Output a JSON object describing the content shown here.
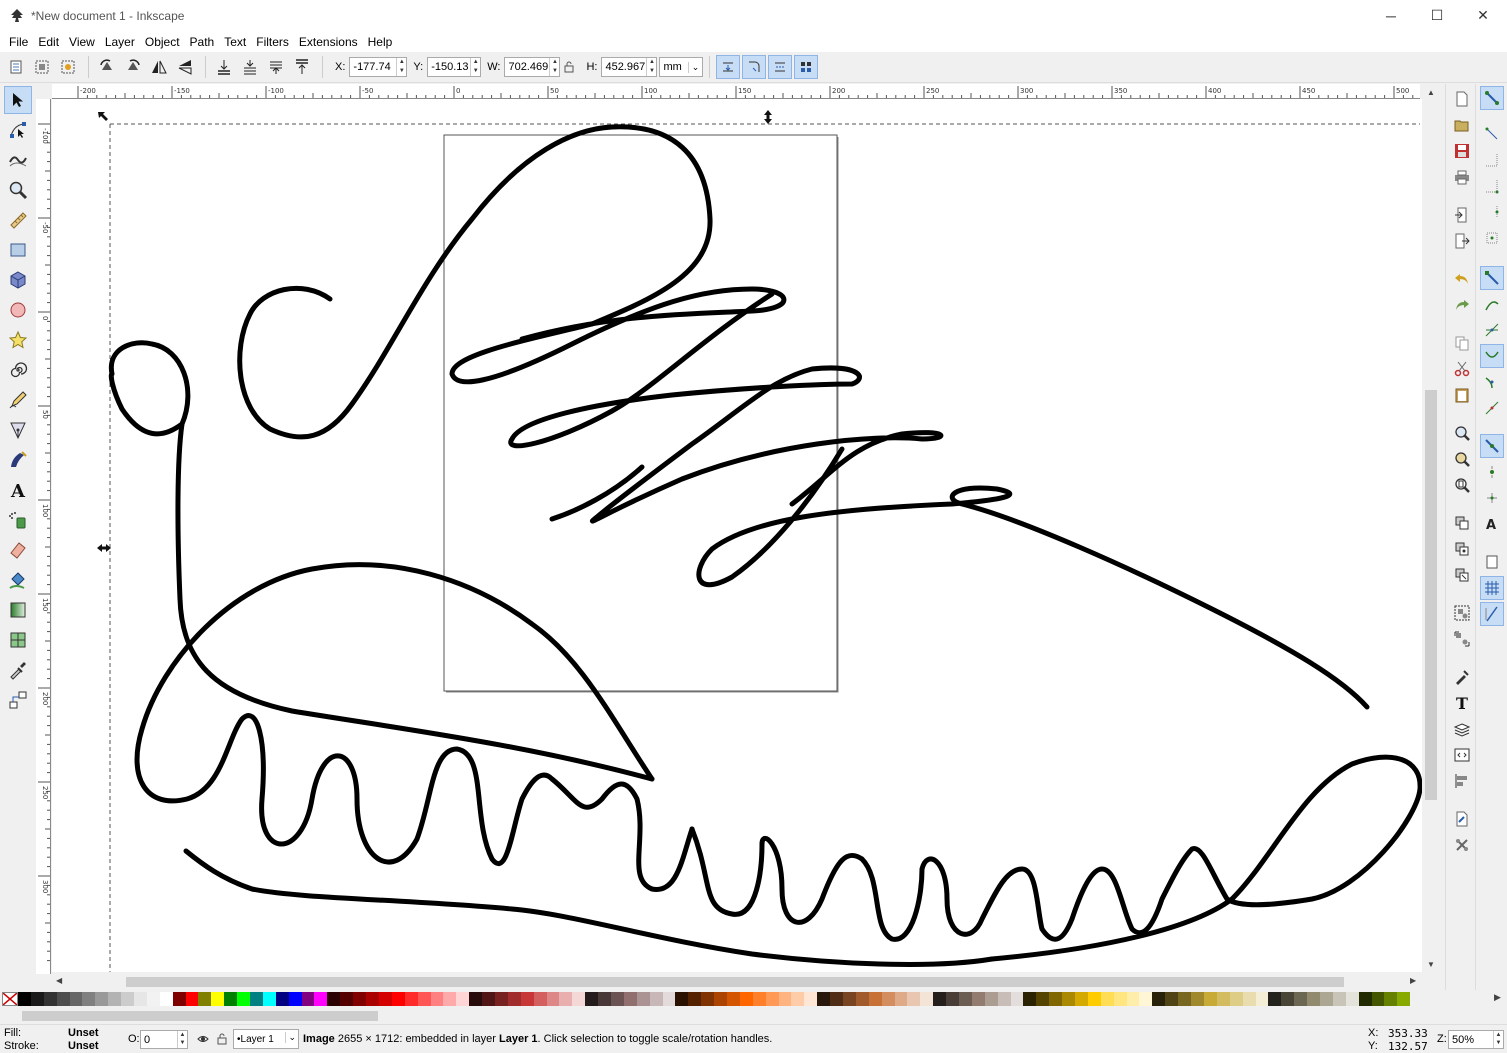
{
  "window": {
    "title": "*New document 1 - Inkscape",
    "minimize_glyph": "─",
    "maximize_glyph": "☐",
    "close_glyph": "✕"
  },
  "menu": [
    {
      "key": "file",
      "label": "File"
    },
    {
      "key": "edit",
      "label": "Edit"
    },
    {
      "key": "view",
      "label": "View"
    },
    {
      "key": "layer",
      "label": "Layer"
    },
    {
      "key": "object",
      "label": "Object"
    },
    {
      "key": "path",
      "label": "Path"
    },
    {
      "key": "text",
      "label": "Text"
    },
    {
      "key": "filters",
      "label": "Filters"
    },
    {
      "key": "extensions",
      "label": "Extensions"
    },
    {
      "key": "help",
      "label": "Help"
    }
  ],
  "toolbar": {
    "x_label": "X:",
    "x_value": "-177.74",
    "y_label": "Y:",
    "y_value": "-150.13",
    "w_label": "W:",
    "w_value": "702.469",
    "h_label": "H:",
    "h_value": "452.967",
    "unit": "mm"
  },
  "rulers": {
    "horizontal_ticks": [
      "-200",
      "-150",
      "-100",
      "-50",
      "0",
      "50",
      "100",
      "150",
      "200",
      "250",
      "300",
      "350",
      "400",
      "450",
      "500"
    ],
    "vertical_ticks": [
      "-100",
      "-50",
      "0",
      "50",
      "100",
      "150",
      "200",
      "250",
      "300"
    ]
  },
  "palette": [
    "#000000",
    "#1a1a1a",
    "#333333",
    "#4d4d4d",
    "#666666",
    "#808080",
    "#999999",
    "#b3b3b3",
    "#cccccc",
    "#e6e6e6",
    "#f2f2f2",
    "#ffffff",
    "#800000",
    "#ff0000",
    "#808000",
    "#ffff00",
    "#008000",
    "#00ff00",
    "#008080",
    "#00ffff",
    "#000080",
    "#0000ff",
    "#800080",
    "#ff00ff",
    "#2b0000",
    "#550000",
    "#800000",
    "#aa0000",
    "#d40000",
    "#ff0000",
    "#ff2a2a",
    "#ff5555",
    "#ff8080",
    "#ffaaaa",
    "#ffd5d5",
    "#280b0b",
    "#501616",
    "#782121",
    "#a02c2c",
    "#c83737",
    "#d35f5f",
    "#de8787",
    "#e9afaf",
    "#f4d7d7",
    "#241c1c",
    "#483737",
    "#6c5353",
    "#916f6f",
    "#ac9393",
    "#c8b7b7",
    "#e3dbdb",
    "#2b1100",
    "#552200",
    "#803300",
    "#aa4400",
    "#d45500",
    "#ff6600",
    "#ff7f2a",
    "#ff9955",
    "#ffb380",
    "#ffccaa",
    "#ffe6d5",
    "#28170b",
    "#502d16",
    "#784421",
    "#a05a2c",
    "#c87137",
    "#d38d5f",
    "#deaa87",
    "#e9c6af",
    "#f4e3d7",
    "#241f1c",
    "#483e37",
    "#6c5d53",
    "#917c6f",
    "#ac9d93",
    "#c8beb7",
    "#e3dedb",
    "#2b2200",
    "#554400",
    "#806600",
    "#aa8800",
    "#d4aa00",
    "#ffcc00",
    "#ffdd55",
    "#ffe680",
    "#ffeeaa",
    "#fff6d5",
    "#28220b",
    "#504416",
    "#786721",
    "#a0892c",
    "#c8ab37",
    "#d3bc5f",
    "#decd87",
    "#e9ddaf",
    "#f4eed7",
    "#24221c",
    "#484537",
    "#6c6753",
    "#918a6f",
    "#aca793",
    "#c8c4b7",
    "#e3e2db",
    "#222b00",
    "#445500",
    "#668000",
    "#88aa00"
  ],
  "status": {
    "fill_label": "Fill:",
    "fill_value": "Unset",
    "stroke_label": "Stroke:",
    "stroke_value": "Unset",
    "opacity_label": "O:",
    "opacity_value": "0",
    "layer": "•Layer 1",
    "message_bold1": "Image",
    "message_mid": " 2655 × 1712: embedded in layer ",
    "message_bold2": "Layer 1",
    "message_end": ". Click selection to toggle scale/rotation handles.",
    "cursor_x_label": "X:",
    "cursor_x": "353.33",
    "cursor_y_label": "Y:",
    "cursor_y": "132.57",
    "zoom_label": "Z:",
    "zoom_value": "50%"
  },
  "colors": {
    "accent": "#c7dcf5",
    "canvas": "#ffffff",
    "chrome": "#f0f0f0"
  }
}
